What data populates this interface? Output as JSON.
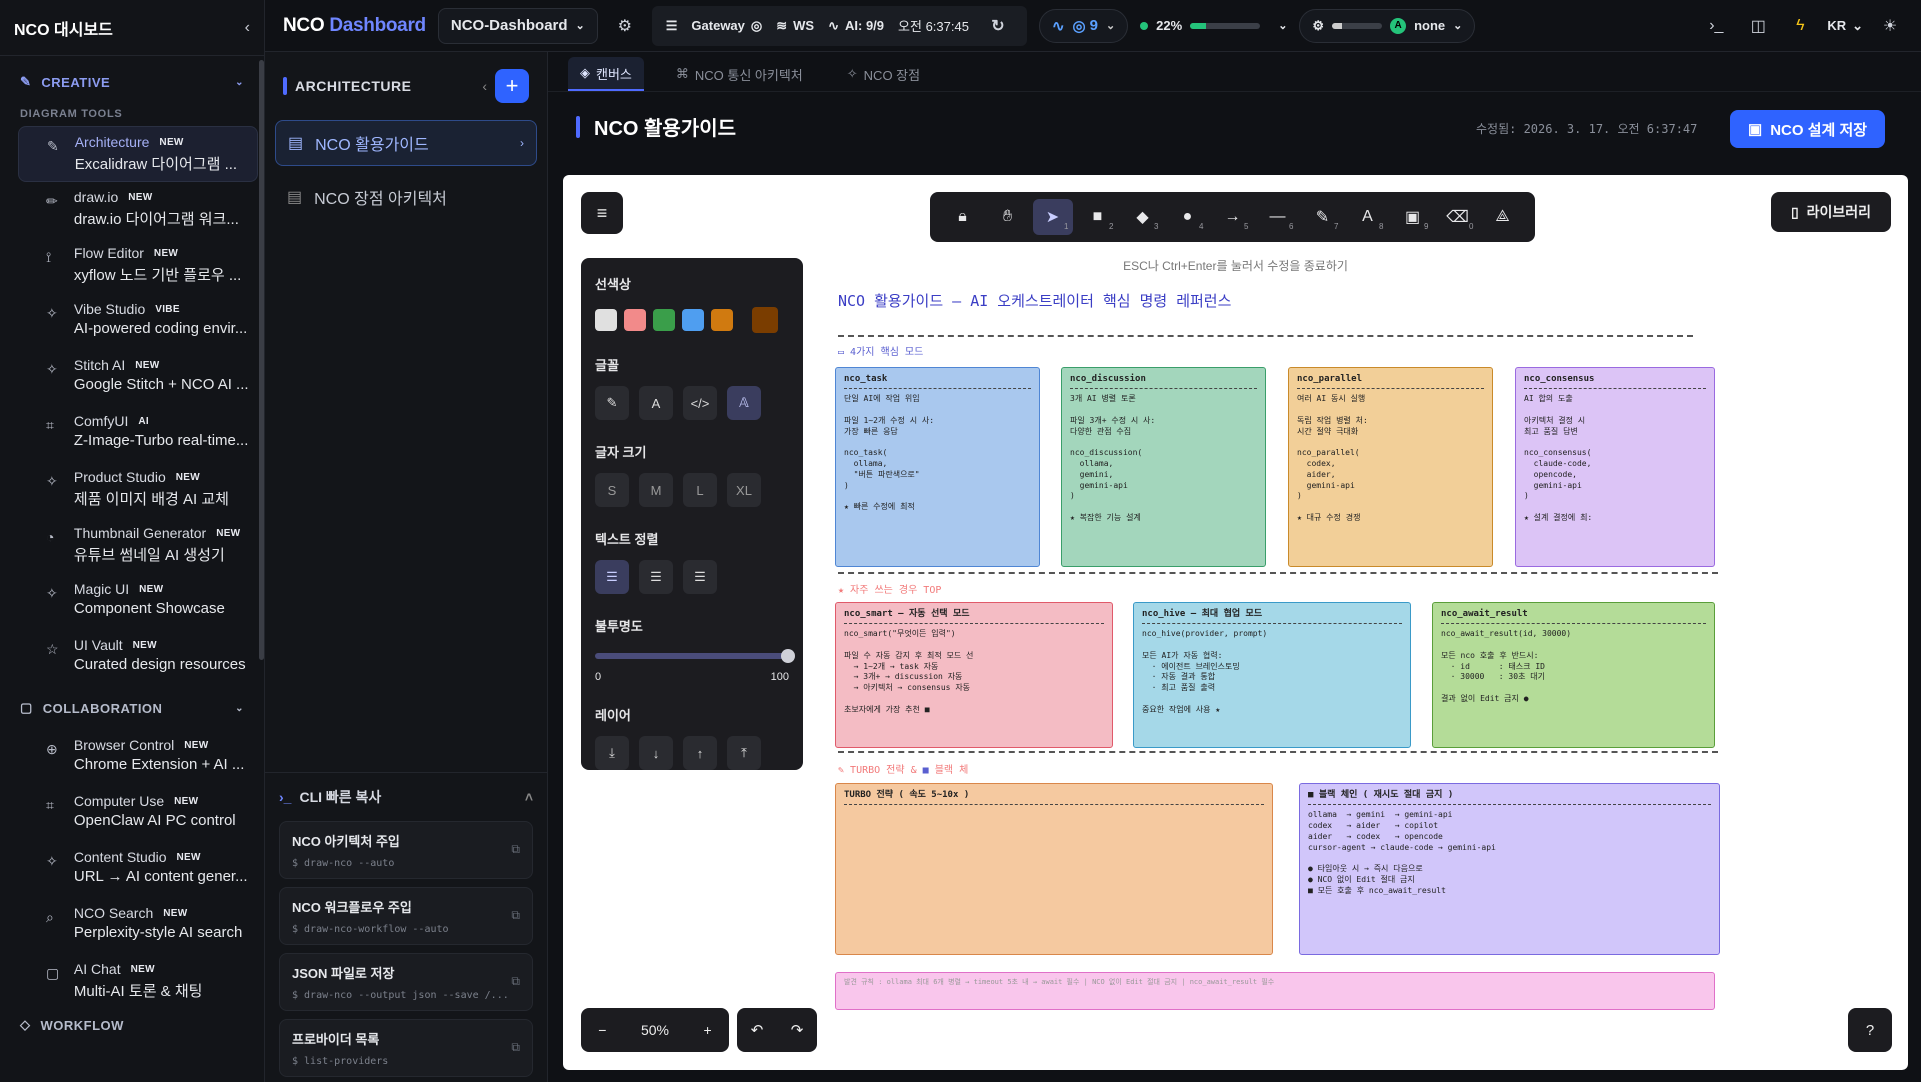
{
  "sidebar": {
    "title": "NCO 대시보드",
    "creative": "CREATIVE",
    "diagram_tools": "DIAGRAM TOOLS",
    "collaboration": "COLLABORATION",
    "workflow": "WORKFLOW",
    "items": [
      {
        "name": "Architecture",
        "badge": "NEW",
        "desc": "Excalidraw 다이어그램 ...",
        "icon": "pen-icon"
      },
      {
        "name": "draw.io",
        "badge": "NEW",
        "desc": "draw.io 다이어그램 워크...",
        "icon": "pencil-icon"
      },
      {
        "name": "Flow Editor",
        "badge": "NEW",
        "desc": "xyflow 노드 기반 플로우 ...",
        "icon": "flow-icon"
      },
      {
        "name": "Vibe Studio",
        "badge": "VIBE",
        "desc": "AI-powered coding envir...",
        "icon": "sparkle-icon"
      },
      {
        "name": "Stitch AI",
        "badge": "NEW",
        "desc": "Google Stitch + NCO AI ...",
        "icon": "sparkle-icon"
      },
      {
        "name": "ComfyUI",
        "badge": "AI",
        "desc": "Z-Image-Turbo real-time...",
        "icon": "chip-icon"
      },
      {
        "name": "Product Studio",
        "badge": "NEW",
        "desc": "제품 이미지 배경 AI 교체",
        "icon": "sparkle-icon"
      },
      {
        "name": "Thumbnail Generator",
        "badge": "NEW",
        "desc": "유튜브 썸네일 AI 생성기",
        "icon": "palette-icon"
      },
      {
        "name": "Magic UI",
        "badge": "NEW",
        "desc": "Component Showcase",
        "icon": "sparkle-icon"
      },
      {
        "name": "UI Vault",
        "badge": "NEW",
        "desc": "Curated design resources",
        "icon": "star-icon"
      }
    ],
    "collab_items": [
      {
        "name": "Browser Control",
        "badge": "NEW",
        "desc": "Chrome Extension + AI ...",
        "icon": "globe-icon"
      },
      {
        "name": "Computer Use",
        "badge": "NEW",
        "desc": "OpenClaw AI PC control",
        "icon": "chip-icon"
      },
      {
        "name": "Content Studio",
        "badge": "NEW",
        "desc": "URL → AI content gener...",
        "icon": "sparkle-icon"
      },
      {
        "name": "NCO Search",
        "badge": "NEW",
        "desc": "Perplexity-style AI search",
        "icon": "search-icon"
      },
      {
        "name": "AI Chat",
        "badge": "NEW",
        "desc": "Multi-AI 토론 & 채팅",
        "icon": "chat-icon"
      }
    ]
  },
  "topbar": {
    "brand_a": "NCO",
    "brand_b": "Dashboard",
    "project": "NCO-Dashboard",
    "gateway": "Gateway",
    "ws": "WS",
    "ai": "AI: 9/9",
    "time": "오전 6:37:45",
    "activity_count": "9",
    "cpu": "22%",
    "cpu_level": 0.22,
    "provider_badge": "A",
    "provider": "none",
    "lang": "KR"
  },
  "arch": {
    "title": "ARCHITECTURE",
    "items": [
      "NCO 활용가이드",
      "NCO 장점 아키텍처"
    ],
    "cli_title": "CLI 빠른 복사",
    "cli": [
      {
        "t": "NCO 아키텍처 주입",
        "c": "$ draw-nco --auto"
      },
      {
        "t": "NCO 워크플로우 주입",
        "c": "$ draw-nco-workflow --auto"
      },
      {
        "t": "JSON 파일로 저장",
        "c": "$ draw-nco --output json --save /..."
      },
      {
        "t": "프로바이더 목록",
        "c": "$ list-providers"
      }
    ]
  },
  "main": {
    "tabs": [
      "캔버스",
      "NCO 통신 아키텍처",
      "NCO 장점"
    ],
    "page_title": "NCO 활용가이드",
    "modified": "수정됨: 2026. 3. 17. 오전 6:37:47",
    "save": "NCO 설계 저장"
  },
  "canvas": {
    "library": "라이브러리",
    "hint": "ESC나 Ctrl+Enter를 눌러서 수정을 종료하기",
    "zoom": "50%",
    "props": {
      "stroke": "선색상",
      "font": "글꼴",
      "size": "글자 크기",
      "sizes": [
        "S",
        "M",
        "L",
        "XL"
      ],
      "align": "텍스트 정렬",
      "opacity": "불투명도",
      "op_min": "0",
      "op_max": "100",
      "layer": "레이어",
      "colors": [
        "#e0e0e0",
        "#f28a8a",
        "#3a9e4a",
        "#4f9ef0",
        "#d07a10",
        "#7a3d00"
      ]
    },
    "tools": [
      "1",
      "2",
      "3",
      "4",
      "5",
      "6",
      "7",
      "8",
      "9",
      "0"
    ],
    "title": "NCO 활용가이드 — AI 오케스트레이터 핵심 명령 레퍼런스",
    "section1": "4가지 핵심 모드",
    "section2": "자주 쓰는 경우 TOP",
    "section3a": "TURBO 전략",
    "section3b": "블랙 체",
    "cards": [
      {
        "hd": "nco_task",
        "body": "단일 AI에 작업 위임\n\n파일 1~2개 수정 시 사:\n가장 빠른 응답\n\nnco_task(\n  ollama,\n  \"버튼 파란색으로\"\n)\n\n★ 빠른 수정에 최적"
      },
      {
        "hd": "nco_discussion",
        "body": "3개 AI 병렬 토론\n\n파일 3개+ 수정 시 사:\n다양한 관점 수집\n\nnco_discussion(\n  ollama,\n  gemini,\n  gemini-api\n)\n\n★ 복잡한 기능 설계"
      },
      {
        "hd": "nco_parallel",
        "body": "여러 AI 동시 실행\n\n독립 작업 병렬 처:\n시간 절약 극대화\n\nnco_parallel(\n  codex,\n  aider,\n  gemini-api\n)\n\n★ 대규 수정 경쟁"
      },
      {
        "hd": "nco_consensus",
        "body": "AI 합의 도출\n\n아키텍처 결정 시\n최고 품질 답변\n\nnco_consensus(\n  claude-code,\n  opencode,\n  gemini-api\n)\n\n★ 설계 결정에 최:"
      },
      {
        "hd": "nco_smart — 자동 선택 모드",
        "body": "nco_smart(\"무엇이든 입력\")\n\n파일 수 자동 감지 후 최적 모드 선\n  → 1~2개 → task 자동\n  → 3개+ → discussion 자동\n  → 아키텍처 → consensus 자동\n\n초보자에게 가장 추천 ■"
      },
      {
        "hd": "nco_hive — 최대 협업 모드",
        "body": "nco_hive(provider, prompt)\n\n모든 AI가 자동 협력:\n  · 에이전트 브레인스토밍\n  · 자동 결과 통합\n  · 최고 품질 출력\n\n중요한 작업에 사용 ★"
      },
      {
        "hd": "nco_await_result",
        "body": "nco_await_result(id, 30000)\n\n모든 nco 호출 후 반드시:\n  · id      : 태스크 ID\n  · 30000   : 30초 대기\n\n결과 없이 Edit 금지 ●"
      },
      {
        "hd": "TURBO 전략 ( 속도 5~10x )",
        "body": ""
      },
      {
        "hd": "■ 블랙 체인 ( 재시도 절대 금지 )",
        "body": "ollama  → gemini  → gemini-api\ncodex   → aider   → copilot\naider   → codex   → opencode\ncursor-agent → claude-code → gemini-api\n\n● 타임아웃 시 → 즉시 다음으로\n● NCO 없이 Edit 절대 금지\n■ 모든 호출 후 nco_await_result"
      },
      {
        "hd": "",
        "body": "발견 규칙 : ollama 최대 6개 병렬 → timeout 5초 내 → await 필수 | NCO 없이 Edit 절대 금지 | nco_await_result 필수"
      }
    ]
  }
}
